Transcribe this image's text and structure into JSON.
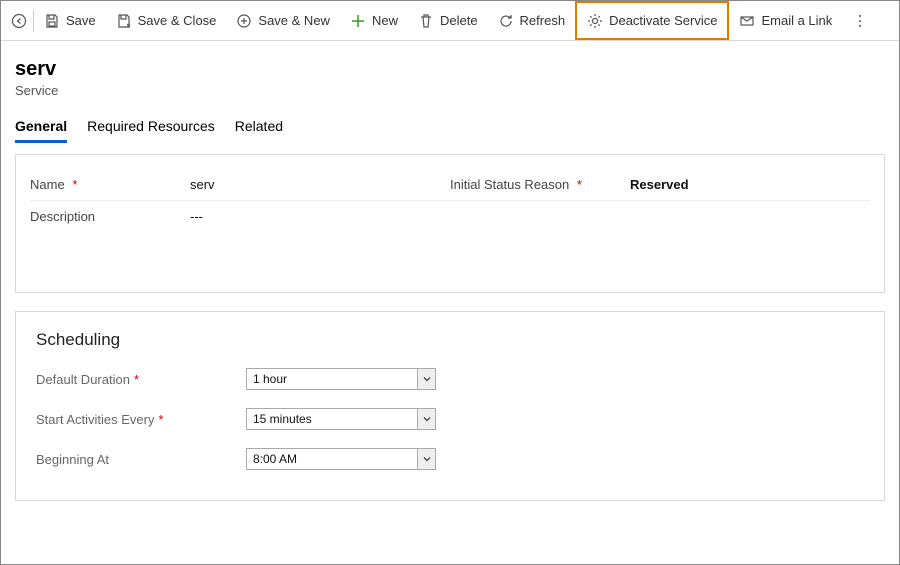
{
  "toolbar": {
    "save": "Save",
    "save_close": "Save & Close",
    "save_new": "Save & New",
    "new": "New",
    "delete": "Delete",
    "refresh": "Refresh",
    "deactivate": "Deactivate Service",
    "email_link": "Email a Link"
  },
  "header": {
    "title": "serv",
    "entity": "Service"
  },
  "tabs": {
    "general": "General",
    "required_resources": "Required Resources",
    "related": "Related"
  },
  "general": {
    "name_label": "Name",
    "name_value": "serv",
    "status_label": "Initial Status Reason",
    "status_value": "Reserved",
    "description_label": "Description",
    "description_value": "---"
  },
  "scheduling": {
    "title": "Scheduling",
    "default_duration_label": "Default Duration",
    "default_duration_value": "1 hour",
    "start_activities_label": "Start Activities Every",
    "start_activities_value": "15 minutes",
    "beginning_at_label": "Beginning At",
    "beginning_at_value": "8:00 AM"
  },
  "glyphs": {
    "asterisk": "*"
  }
}
